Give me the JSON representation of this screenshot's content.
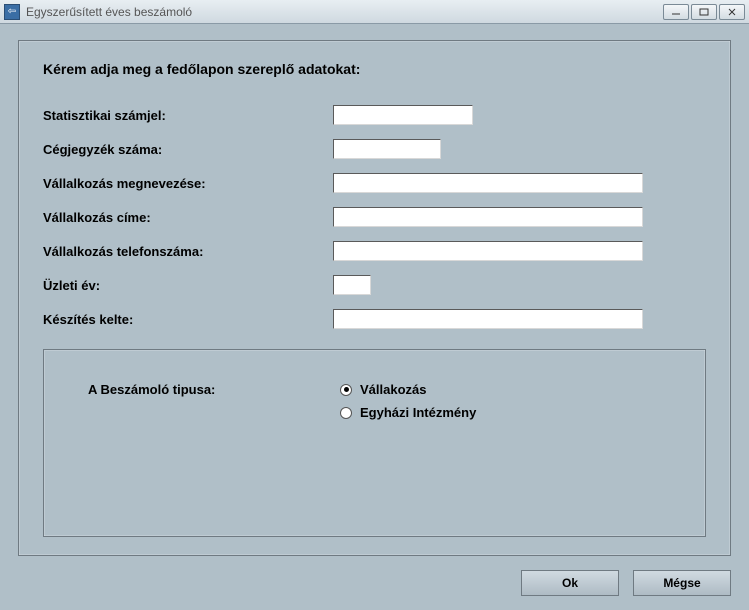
{
  "window": {
    "title": "Egyszerűsített éves beszámoló"
  },
  "form": {
    "heading": "Kérem adja meg a fedőlapon szereplő adatokat:",
    "stat_label": "Statisztikai számjel:",
    "stat_value": "",
    "reg_label": "Cégjegyzék száma:",
    "reg_value": "",
    "company_name_label": "Vállalkozás megnevezése:",
    "company_name_value": "",
    "company_addr_label": "Vállalkozás címe:",
    "company_addr_value": "",
    "company_phone_label": "Vállalkozás telefonszáma:",
    "company_phone_value": "",
    "year_label": "Üzleti év:",
    "year_value": "",
    "date_label": "Készítés kelte:",
    "date_value": ""
  },
  "type_section": {
    "label": "A Beszámoló tipusa:",
    "options": {
      "option1": "Vállakozás",
      "option2": "Egyházi Intézmény"
    },
    "selected": "option1"
  },
  "buttons": {
    "ok": "Ok",
    "cancel": "Mégse"
  }
}
